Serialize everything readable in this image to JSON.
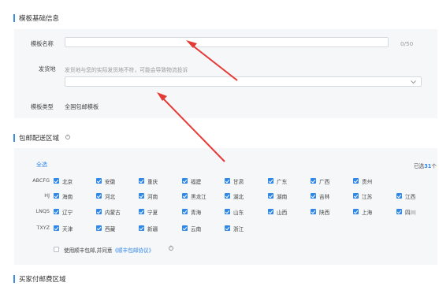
{
  "basic": {
    "title": "模板基础信息",
    "template_name_label": "模板名称",
    "template_name_value": "",
    "template_name_counter": "0/50",
    "ship_from_label": "发货地",
    "ship_from_hint": "发货地与您的实际发货地不符，可能会导致物流投诉",
    "ship_from_value": "",
    "template_type_label": "模板类型",
    "template_type_value": "全国包邮模板"
  },
  "free_area": {
    "title": "包邮配送区域",
    "select_all": "全选",
    "selected_count_prefix": "已选",
    "selected_count": "31",
    "selected_count_suffix": "个",
    "groups": [
      {
        "code": "ABCFG",
        "provinces": [
          "北京",
          "安徽",
          "重庆",
          "福建",
          "甘肃",
          "广东",
          "广西",
          "贵州"
        ]
      },
      {
        "code": "HJ",
        "provinces": [
          "海南",
          "河北",
          "河南",
          "黑龙江",
          "湖北",
          "湖南",
          "吉林",
          "江苏",
          "江西"
        ]
      },
      {
        "code": "LNQS",
        "provinces": [
          "辽宁",
          "内蒙古",
          "宁夏",
          "青海",
          "山东",
          "山西",
          "陕西",
          "上海",
          "四川"
        ]
      },
      {
        "code": "TXYZ",
        "provinces": [
          "天津",
          "西藏",
          "新疆",
          "云南",
          "浙江"
        ]
      }
    ],
    "sf_text": "使用顺丰包邮,并同意",
    "sf_link": "《顺丰包邮协议》"
  },
  "paid_area": {
    "title": "买家付邮费区域"
  },
  "colors": {
    "accent": "#2f87e9",
    "arrow": "#e53935"
  },
  "icons": [
    "info-icon",
    "chevron-down-icon",
    "checkbox-icon"
  ]
}
